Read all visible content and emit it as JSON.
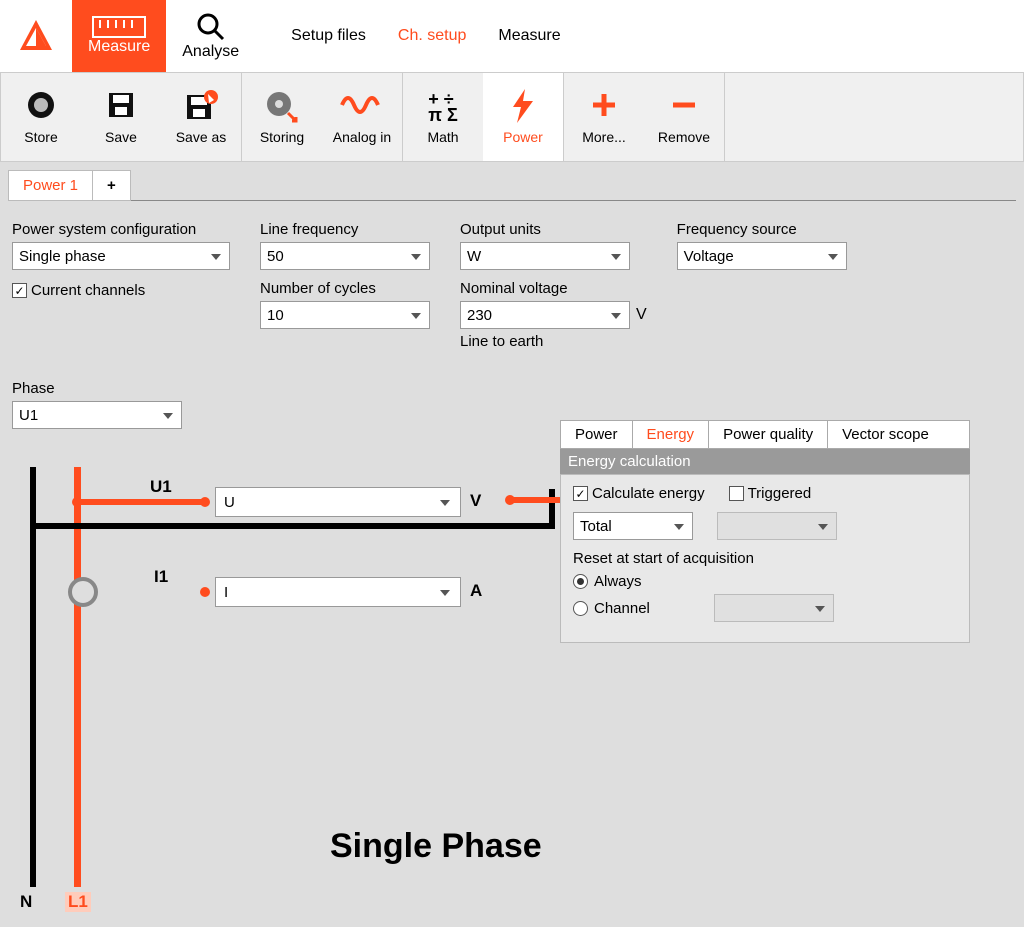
{
  "topMenu": {
    "measure": "Measure",
    "analyse": "Analyse",
    "setupFiles": "Setup files",
    "chSetup": "Ch. setup",
    "measure2": "Measure"
  },
  "toolbar": {
    "store": "Store",
    "save": "Save",
    "saveAs": "Save as",
    "storing": "Storing",
    "analogIn": "Analog in",
    "math": "Math",
    "power": "Power",
    "more": "More...",
    "remove": "Remove"
  },
  "pageTabs": {
    "power1": "Power 1",
    "add": "+"
  },
  "config": {
    "powerSystemConfig": {
      "label": "Power system configuration",
      "value": "Single phase"
    },
    "currentChannels": "Current channels",
    "lineFrequency": {
      "label": "Line frequency",
      "value": "50"
    },
    "numberOfCycles": {
      "label": "Number of cycles",
      "value": "10"
    },
    "outputUnits": {
      "label": "Output units",
      "value": "W"
    },
    "nominalVoltage": {
      "label": "Nominal voltage",
      "value": "230",
      "unit": "V",
      "sub": "Line to earth"
    },
    "frequencySource": {
      "label": "Frequency source",
      "value": "Voltage"
    },
    "phase": {
      "label": "Phase",
      "value": "U1"
    }
  },
  "wiring": {
    "u1": "U1",
    "i1": "I1",
    "uSelect": "U",
    "iSelect": "I",
    "uUnit": "V",
    "iUnit": "A",
    "n": "N",
    "l1": "L1",
    "title": "Single Phase"
  },
  "subTabs": {
    "power": "Power",
    "energy": "Energy",
    "powerQuality": "Power quality",
    "vectorScope": "Vector scope"
  },
  "energyPanel": {
    "header": "Energy calculation",
    "calculateEnergy": "Calculate energy",
    "triggered": "Triggered",
    "totalSelect": "Total",
    "resetLabel": "Reset at start of acquisition",
    "always": "Always",
    "channel": "Channel"
  }
}
